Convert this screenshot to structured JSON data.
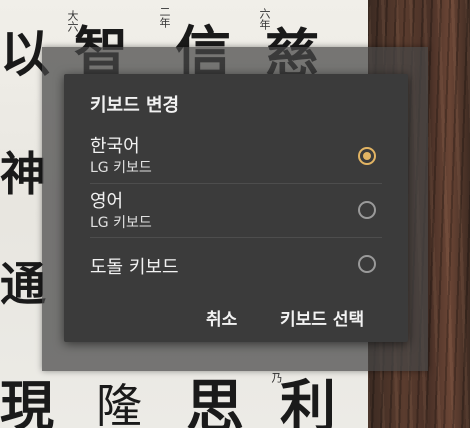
{
  "background": {
    "large_glyphs": [
      "以",
      "智",
      "信",
      "慈",
      "神",
      "通",
      "現",
      "隆",
      "思",
      "利"
    ],
    "small_glyphs": [
      "大六",
      "二年",
      "六年",
      "乃"
    ]
  },
  "dialog": {
    "title": "키보드 변경",
    "options": [
      {
        "name": "한국어",
        "sub": "LG 키보드",
        "selected": true
      },
      {
        "name": "영어",
        "sub": "LG 키보드",
        "selected": false
      },
      {
        "name": "도돌 키보드",
        "sub": "",
        "selected": false
      }
    ],
    "cancel_label": "취소",
    "select_label": "키보드 선택"
  },
  "colors": {
    "dialog_bg": "#3b3b3b",
    "accent": "#e2b463",
    "radio_unchecked": "#9a9a9a"
  }
}
